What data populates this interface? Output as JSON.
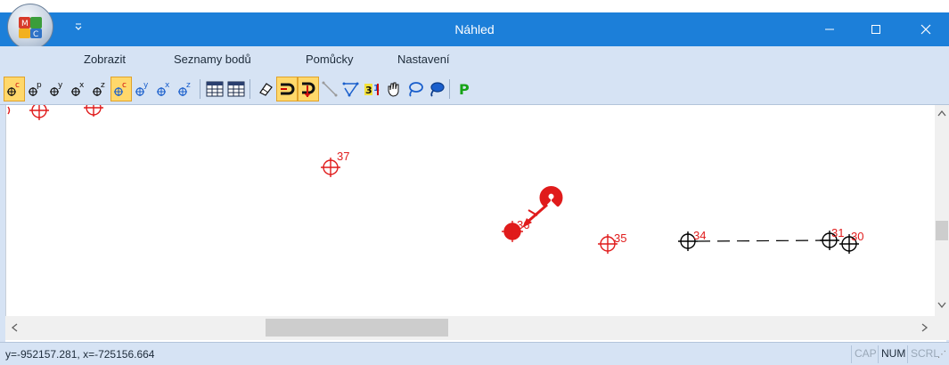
{
  "window": {
    "title": "Náhled",
    "quick_access_icon": "chevron-down-icon",
    "minimize_icon": "minimize-icon",
    "maximize_icon": "maximize-icon",
    "close_icon": "close-icon"
  },
  "menu": {
    "items": [
      {
        "label": "Zobrazit"
      },
      {
        "label": "Seznamy bodů"
      },
      {
        "label": "Pomůcky"
      },
      {
        "label": "Nastavení"
      }
    ]
  },
  "toolbar": {
    "buttons": [
      {
        "icon": "point-c-icon",
        "glyph": "c",
        "active": true
      },
      {
        "icon": "point-p-icon",
        "glyph": "p",
        "active": false
      },
      {
        "icon": "point-y-icon",
        "glyph": "y",
        "active": false
      },
      {
        "icon": "point-x-icon",
        "glyph": "x",
        "active": false
      },
      {
        "icon": "point-z-icon",
        "glyph": "z",
        "active": false
      },
      {
        "icon": "point-c-icon",
        "glyph": "c",
        "active": true
      },
      {
        "icon": "point-y-icon",
        "glyph": "y",
        "active": false
      },
      {
        "icon": "point-x-icon",
        "glyph": "x",
        "active": false
      },
      {
        "icon": "point-z-icon",
        "glyph": "z",
        "active": false
      },
      {
        "icon": "table-icon",
        "active": false
      },
      {
        "icon": "table-icon",
        "active": false
      },
      {
        "icon": "eraser-icon",
        "active": false
      },
      {
        "icon": "magnet-icon",
        "active": true
      },
      {
        "icon": "magnet-pin-icon",
        "active": true
      },
      {
        "icon": "line-icon",
        "active": false
      },
      {
        "icon": "polyline-icon",
        "active": false
      },
      {
        "icon": "numbering-icon",
        "active": false
      },
      {
        "icon": "hand-icon",
        "active": false
      },
      {
        "icon": "lasso-icon",
        "active": false
      },
      {
        "icon": "lasso-fill-icon",
        "active": false
      },
      {
        "icon": "p-icon",
        "glyph": "P",
        "active": false
      }
    ]
  },
  "canvas": {
    "points": [
      {
        "label": "37",
        "color": "#e01b1b"
      },
      {
        "label": "36",
        "color": "#e01b1b"
      },
      {
        "label": "35",
        "color": "#e01b1b"
      },
      {
        "label": "34",
        "color": "#e01b1b"
      },
      {
        "label": "31",
        "color": "#e01b1b"
      },
      {
        "label": "30",
        "color": "#e01b1b"
      }
    ],
    "line_color": "#000000",
    "point_color": "#e01b1b"
  },
  "statusbar": {
    "coordinates": "y=-952157.281, x=-725156.664",
    "indicators": [
      {
        "label": "CAP",
        "active": false
      },
      {
        "label": "NUM",
        "active": true
      },
      {
        "label": "SCRL",
        "active": false
      }
    ]
  },
  "colors": {
    "title_bar": "#1c7fd9",
    "ribbon": "#d6e3f4",
    "point_red": "#e01b1b",
    "active_tool": "#ffd86b"
  }
}
